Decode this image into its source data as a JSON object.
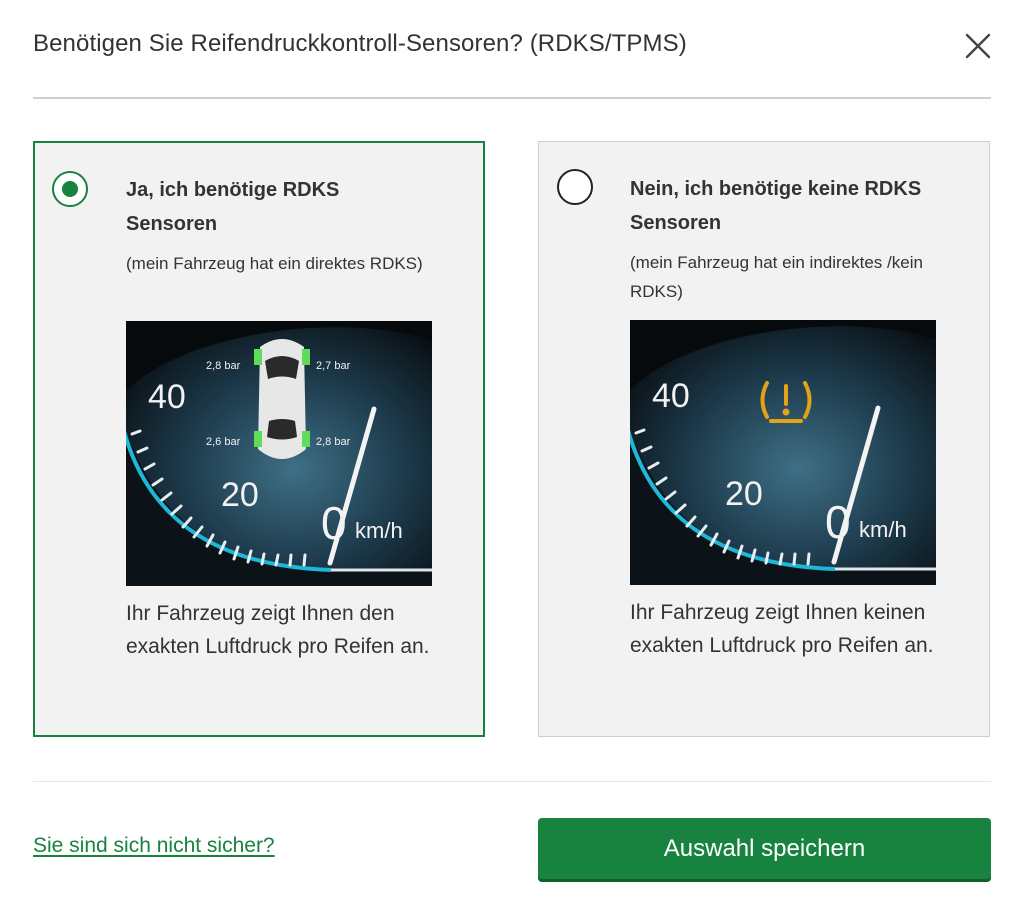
{
  "dialog": {
    "title": "Benötigen Sie Reifendruckkontroll-Sensoren? (RDKS/TPMS)",
    "close_icon": "close-icon"
  },
  "options": [
    {
      "selected": true,
      "title": "Ja, ich benötige RDKS Sensoren",
      "subtitle": "(mein Fahrzeug hat ein direktes RDKS)",
      "description": "Ihr Fahrzeug zeigt Ihnen den exakten Luftdruck pro Reifen an.",
      "dashboard": {
        "speed_40": "40",
        "speed_20": "20",
        "speed_0": "0",
        "unit": "km/h",
        "pressure_front_left": "2,8 bar",
        "pressure_front_right": "2,7 bar",
        "pressure_rear_left": "2,6 bar",
        "pressure_rear_right": "2,8 bar"
      }
    },
    {
      "selected": false,
      "title": "Nein, ich benötige keine RDKS Sensoren",
      "subtitle": "(mein Fahrzeug hat ein indirektes /kein RDKS)",
      "description": "Ihr Fahrzeug zeigt Ihnen keinen exakten Luftdruck pro Reifen an.",
      "dashboard": {
        "speed_40": "40",
        "speed_20": "20",
        "speed_0": "0",
        "unit": "km/h",
        "warning_icon": "tpms-warning-icon"
      }
    }
  ],
  "footer": {
    "unsure_link": "Sie sind sich nicht sicher?",
    "save_button": "Auswahl speichern"
  },
  "colors": {
    "accent": "#17833f",
    "card_bg": "#f2f2f2",
    "gauge_cyan": "#1fb6d8",
    "warning_amber": "#e3a21a",
    "tire_green": "#5fdc5a"
  }
}
